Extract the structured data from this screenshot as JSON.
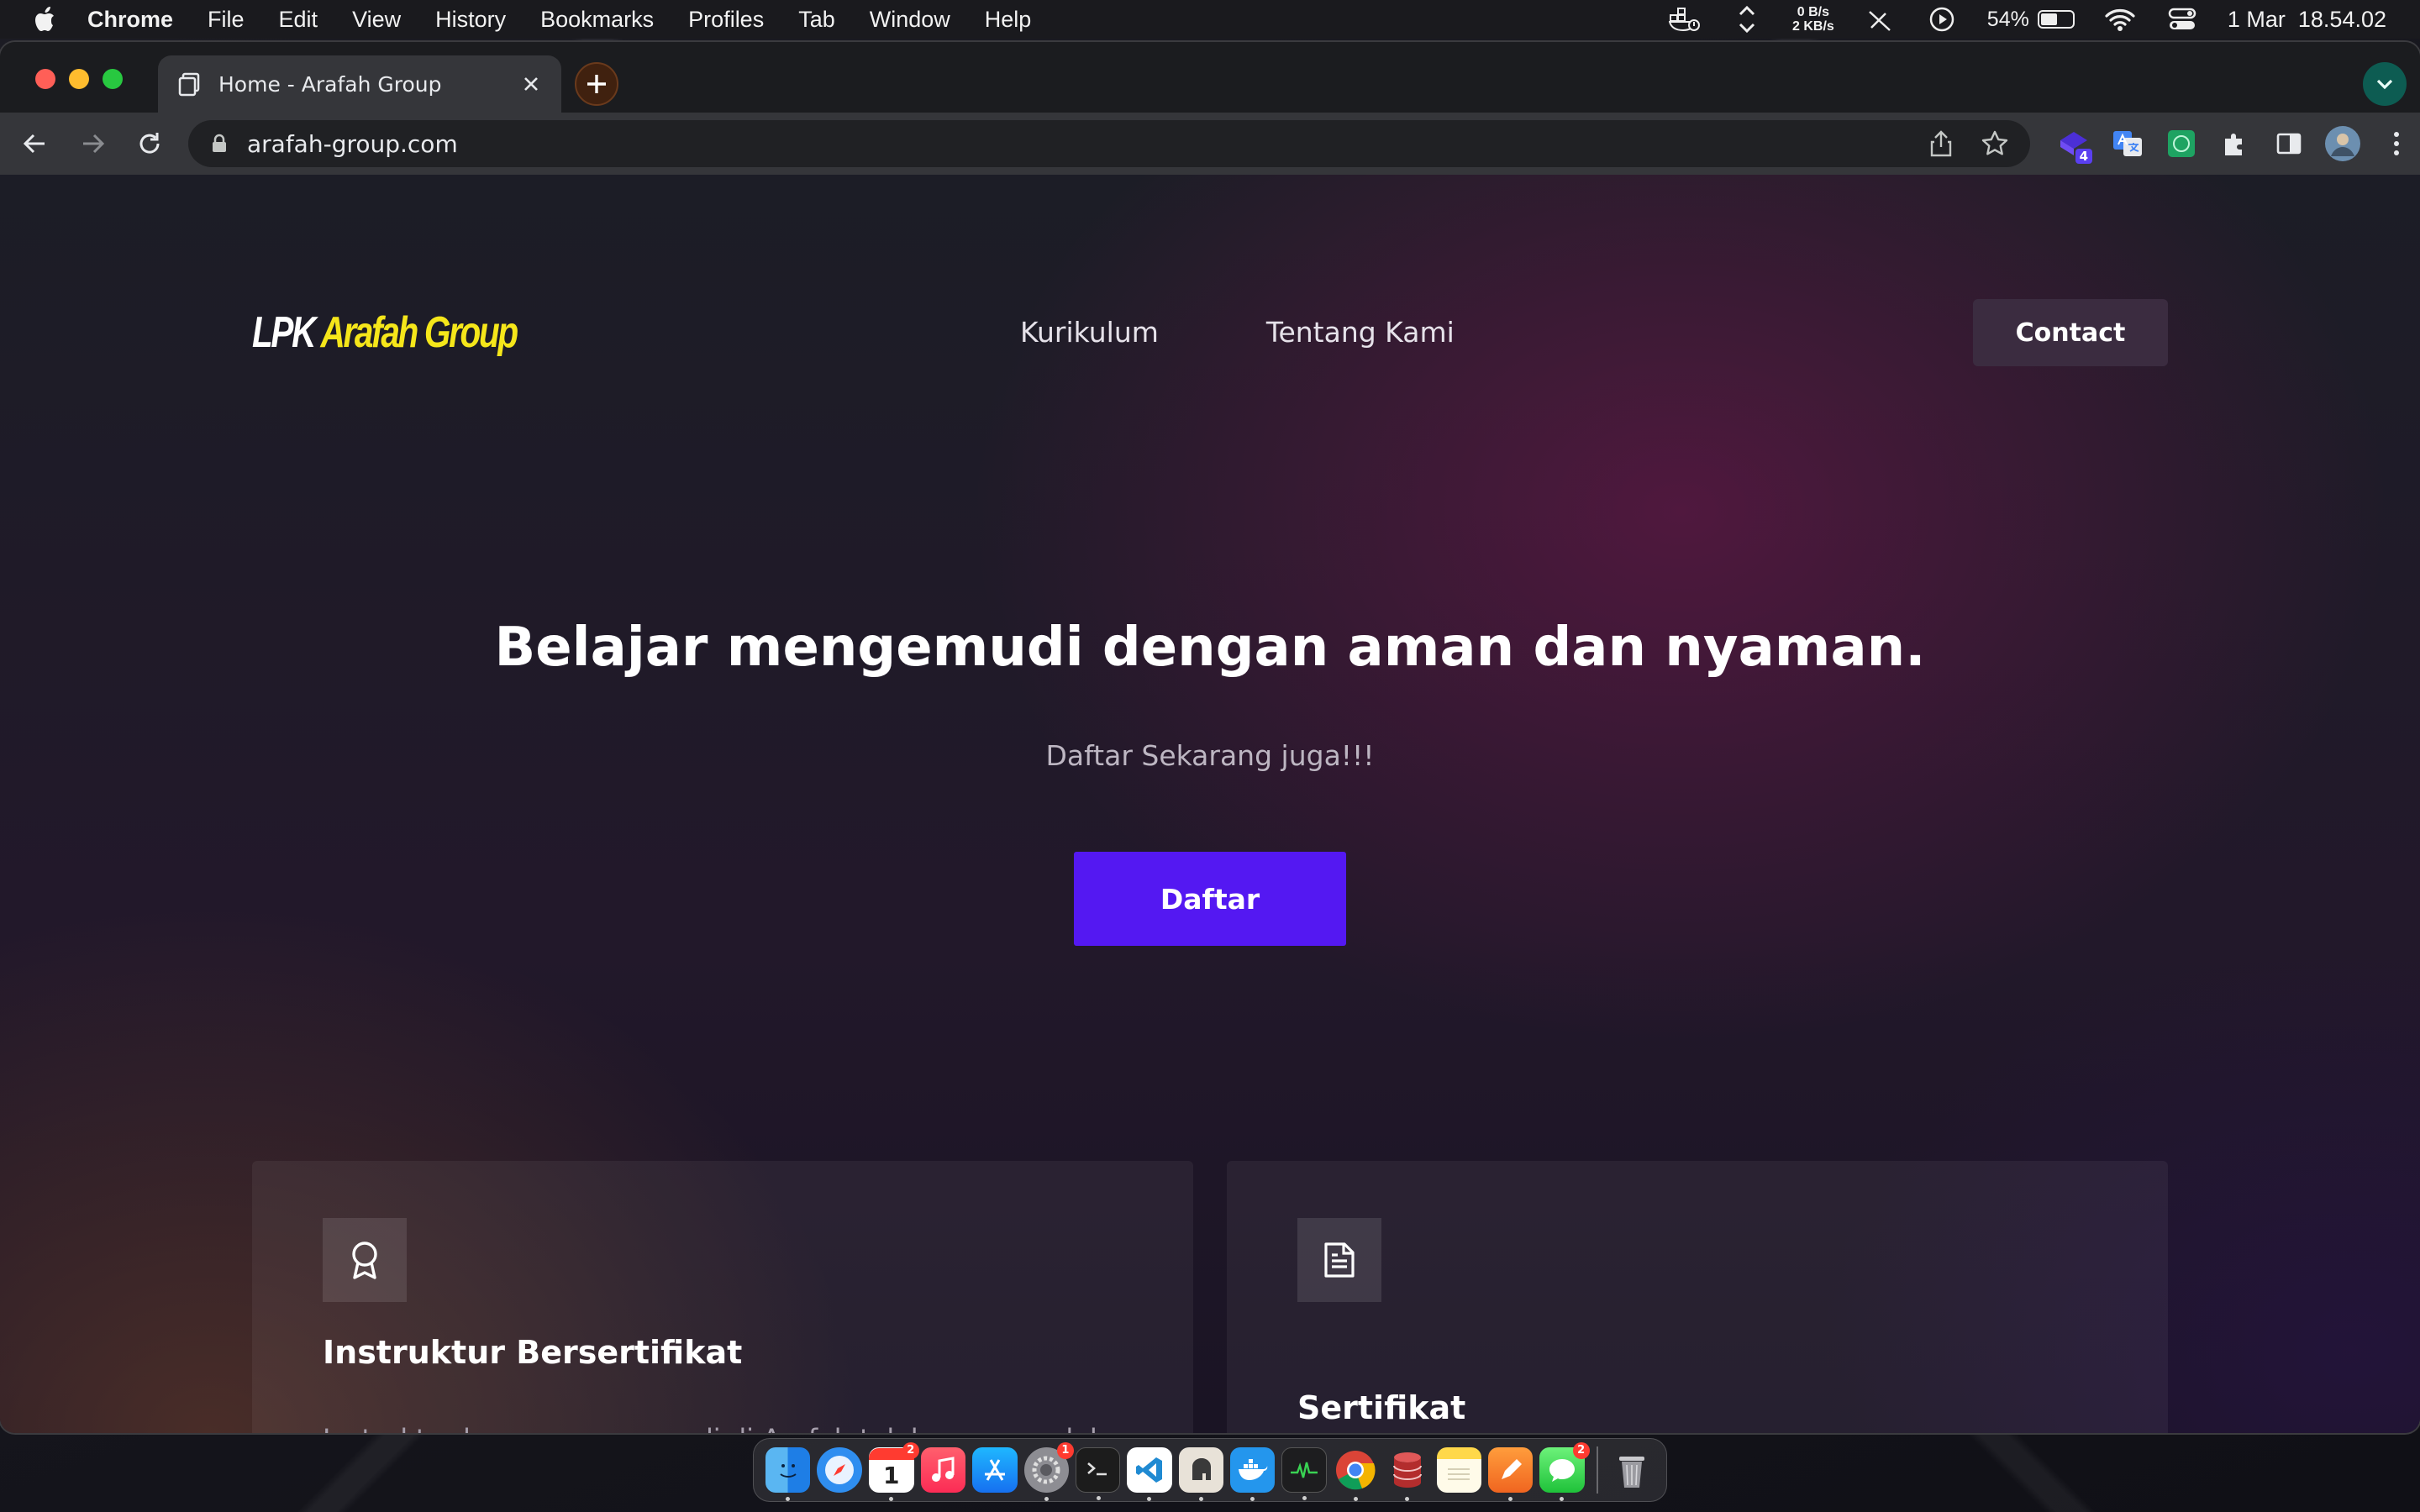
{
  "menubar": {
    "app_name": "Chrome",
    "menus": [
      "File",
      "Edit",
      "View",
      "History",
      "Bookmarks",
      "Profiles",
      "Tab",
      "Window",
      "Help"
    ],
    "network_up": "0 B/s",
    "network_down": "2 KB/s",
    "battery_percent": "54%",
    "battery_level": 0.54,
    "date": "1 Mar",
    "time": "18.54.02"
  },
  "browser": {
    "tab_title": "Home - Arafah Group",
    "url": "arafah-group.com",
    "extension_badge": "4"
  },
  "site": {
    "logo_part1": "LPK",
    "logo_part2": "Arafah Group",
    "nav": [
      "Kurikulum",
      "Tentang Kami"
    ],
    "contact_label": "Contact",
    "hero_title": "Belajar mengemudi dengan aman dan nyaman.",
    "hero_subtitle": "Daftar Sekarang juga!!!",
    "cta_label": "Daftar",
    "features": [
      {
        "icon": "award-icon",
        "title": "Instruktur Bersertifikat",
        "text": "Instruktur kursus mengemudi di Arafah telah memperoleh"
      },
      {
        "icon": "document-icon",
        "title": "Sertifikat",
        "text": ""
      }
    ]
  },
  "dock": {
    "apps": [
      "Finder",
      "Safari",
      "Calendar",
      "Music",
      "App Store",
      "System Preferences",
      "Terminal",
      "Visual Studio Code",
      "Sequel Ace",
      "Docker",
      "Activity Monitor",
      "Google Chrome",
      "Database",
      "Notes",
      "Sketch",
      "Messages",
      "Trash"
    ],
    "calendar_badge": "2",
    "calendar_date": "1",
    "settings_badge": "1",
    "messages_badge": "2"
  },
  "colors": {
    "brand_yellow": "#f5e61a",
    "cta_purple": "#5418f2",
    "contact_bg": "#3b2c40"
  }
}
